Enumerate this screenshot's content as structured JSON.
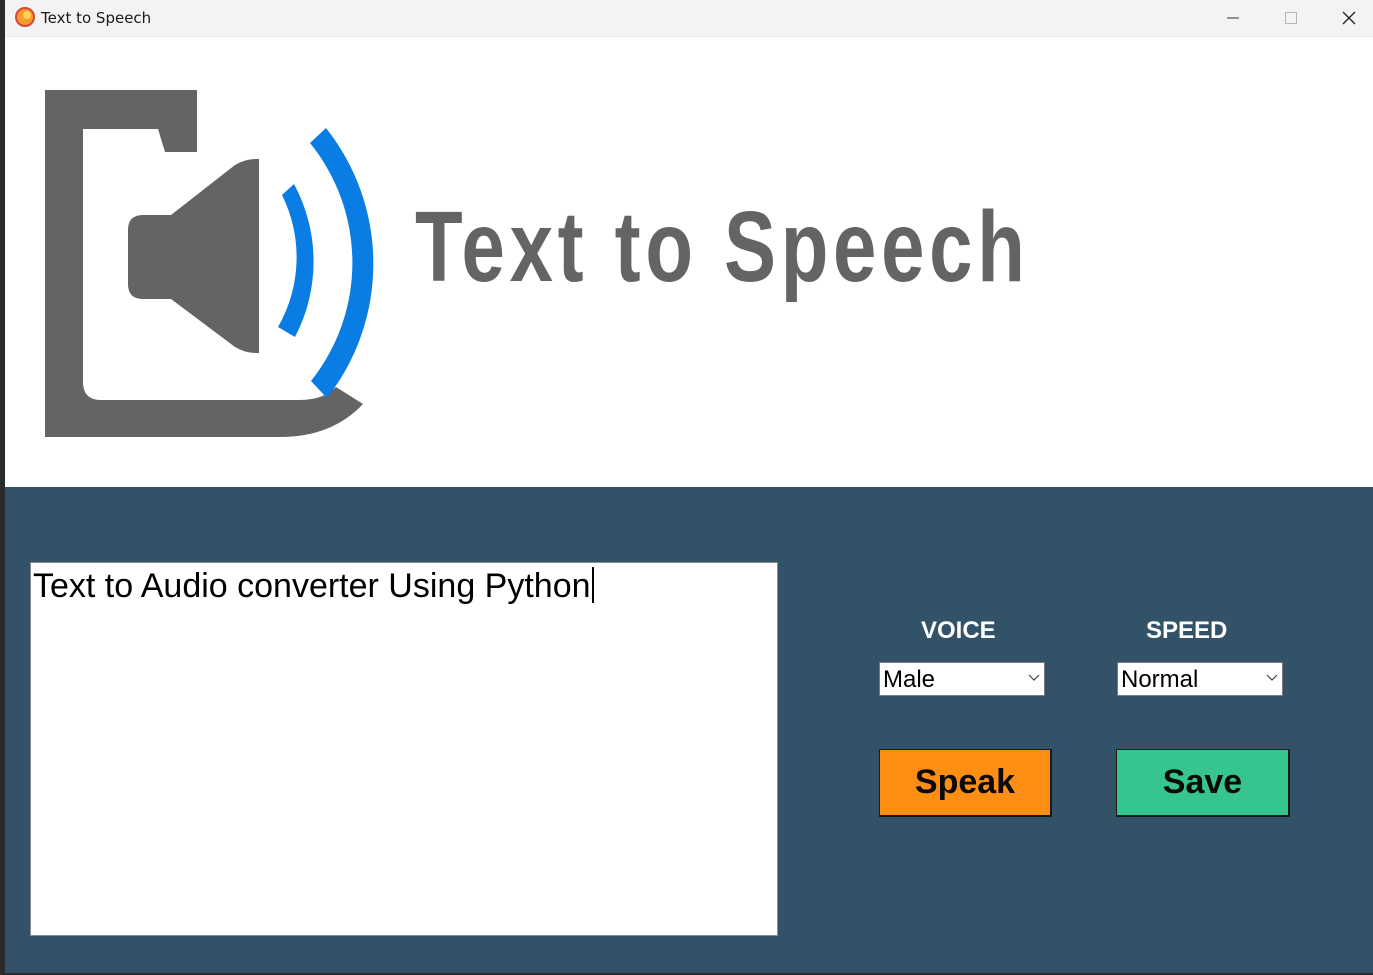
{
  "window": {
    "title": "Text to Speech",
    "controls": [
      "minimize-icon",
      "maximize-icon",
      "close-icon"
    ]
  },
  "header": {
    "logo_icon": "speaker-sound-wave-icon",
    "logo_text": "Text to Speech"
  },
  "editor": {
    "text": "Text to Audio converter Using Python"
  },
  "voice": {
    "label": "VOICE",
    "selected": "Male"
  },
  "speed": {
    "label": "SPEED",
    "selected": "Normal"
  },
  "actions": {
    "speak_label": "Speak",
    "save_label": "Save"
  },
  "colors": {
    "panel_background": "#325267",
    "speak_button": "#fd8d13",
    "save_button": "#37c58f",
    "logo_gray": "#646464",
    "logo_blue": "#0a7de4"
  }
}
